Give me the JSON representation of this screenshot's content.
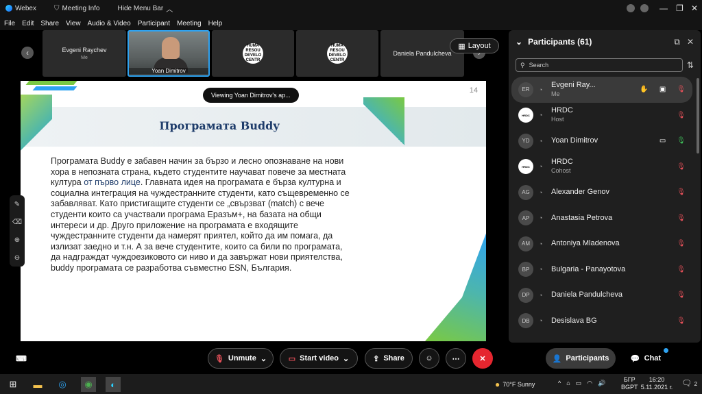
{
  "titlebar": {
    "app": "Webex",
    "meeting_info": "Meeting Info",
    "hide_menu": "Hide Menu Bar"
  },
  "menubar": [
    "File",
    "Edit",
    "Share",
    "View",
    "Audio & Video",
    "Participant",
    "Meeting",
    "Help"
  ],
  "thumbnails": [
    {
      "name": "Evgeni Raychev",
      "sub": "Me"
    },
    {
      "name": "Yoan Dimitrov",
      "sub": ""
    },
    {
      "name": "HRDC-logo-1",
      "sub": ""
    },
    {
      "name": "HRDC-logo-2",
      "sub": ""
    },
    {
      "name": "Daniela Pandulcheva",
      "sub": ""
    }
  ],
  "hr_logo_text": "HUMA\nRESOU\nDEVELO\nCENTR",
  "layout_label": "Layout",
  "viewing_label": "Viewing Yoan Dimitrov's ap...",
  "slide": {
    "number": "14",
    "title": "Програмата Buddy",
    "body_1": "Програмата Buddy е забавен начин за бързо и лесно опознаване на нови хора в непозната страна, където студентите научават повече за местната култура ",
    "body_hl": "от първо лице",
    "body_2": ". Главната идея на програмата е бърза културна и социална интеграция на чуждестранните студенти, като същевременно се забавляват. Като пристигащите студенти се „свързват (match) с вече студенти които са участвали програма Еразъм+, на базата на общи интереси и др. Друго приложение на програмата е входящите чуждестранните студенти да намерят приятел, който да им помага, да излизат заедно и т.н. А за вече студентите, които са били по програмата, да надграждат чуждоезиковото си ниво и да завържат нови приятелства, buddy програмата се разработва съвместно ESN, България."
  },
  "participants_panel": {
    "title": "Participants (61)",
    "search_placeholder": "Search",
    "list": [
      {
        "initials": "ER",
        "name": "Evgeni Ray...",
        "role": "Me",
        "mic": "muted",
        "selected": true
      },
      {
        "initials": "HR",
        "name": "HRDC",
        "role": "Host",
        "mic": "muted",
        "logo": true
      },
      {
        "initials": "YD",
        "name": "Yoan Dimitrov",
        "role": "",
        "mic": "on",
        "video": true
      },
      {
        "initials": "HR",
        "name": "HRDC",
        "role": "Cohost",
        "mic": "muted",
        "logo": true
      },
      {
        "initials": "AG",
        "name": "Alexander Genov",
        "role": "",
        "mic": "muted"
      },
      {
        "initials": "AP",
        "name": "Anastasia Petrova",
        "role": "",
        "mic": "muted"
      },
      {
        "initials": "AM",
        "name": "Antoniya Mladenova",
        "role": "",
        "mic": "muted"
      },
      {
        "initials": "BP",
        "name": "Bulgaria - Panayotova",
        "role": "",
        "mic": "muted"
      },
      {
        "initials": "DP",
        "name": "Daniela Pandulcheva",
        "role": "",
        "mic": "muted"
      },
      {
        "initials": "DB",
        "name": "Desislava BG",
        "role": "",
        "mic": "muted"
      }
    ]
  },
  "controls": {
    "unmute": "Unmute",
    "start_video": "Start video",
    "share": "Share",
    "participants": "Participants",
    "chat": "Chat"
  },
  "taskbar": {
    "weather": "70°F  Sunny",
    "lang_1": "БГР",
    "lang_2": "BGPT",
    "time": "16:20",
    "date": "5.11.2021 г.",
    "notif": "2"
  }
}
